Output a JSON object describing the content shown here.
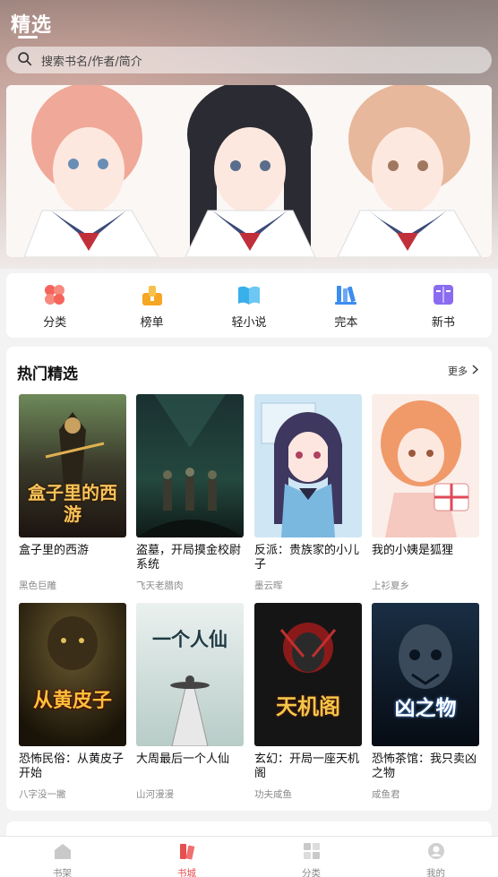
{
  "header": {
    "title": "精选",
    "search_placeholder": "搜索书名/作者/简介"
  },
  "banner": {
    "image": "anime-schoolgirls-illustration"
  },
  "quick_nav": [
    {
      "label": "分类",
      "icon": "category-icon",
      "color": "#f4645a"
    },
    {
      "label": "榜单",
      "icon": "ranking-icon",
      "color": "#f5a623"
    },
    {
      "label": "轻小说",
      "icon": "light-novel-icon",
      "color": "#3ab0ea"
    },
    {
      "label": "完本",
      "icon": "finished-books-icon",
      "color": "#3d8cf0"
    },
    {
      "label": "新书",
      "icon": "new-book-icon",
      "color": "#8a6cf0"
    }
  ],
  "hot": {
    "title": "热门精选",
    "more": "更多",
    "books": [
      {
        "title": "盒子里的西游",
        "author": "黑色巨雕",
        "cover_text": "盒子里的西游"
      },
      {
        "title": "盗墓，开局摸金校尉系统",
        "author": "飞天老腊肉",
        "cover_text": ""
      },
      {
        "title": "反派：贵族家的小儿子",
        "author": "墨云晖",
        "cover_text": ""
      },
      {
        "title": "我的小姨是狐狸",
        "author": "上衫夏乡",
        "cover_text": ""
      },
      {
        "title": "恐怖民俗：从黄皮子开始",
        "author": "八字没一撇",
        "cover_text": "从黄皮子"
      },
      {
        "title": "大周最后一个人仙",
        "author": "山河漫漫",
        "cover_text": "一个人仙"
      },
      {
        "title": "玄幻：开局一座天机阁",
        "author": "功夫咸鱼",
        "cover_text": "天机阁"
      },
      {
        "title": "恐怖茶馆：我只卖凶之物",
        "author": "咸鱼君",
        "cover_text": "凶之物"
      }
    ]
  },
  "tabs": [
    {
      "label": "书架",
      "icon": "bookshelf-icon",
      "active": false
    },
    {
      "label": "书城",
      "icon": "bookstore-icon",
      "active": true
    },
    {
      "label": "分类",
      "icon": "category-grid-icon",
      "active": false
    },
    {
      "label": "我的",
      "icon": "profile-icon",
      "active": false
    }
  ],
  "colors": {
    "accent": "#e85050",
    "muted": "#8a8a8a"
  }
}
